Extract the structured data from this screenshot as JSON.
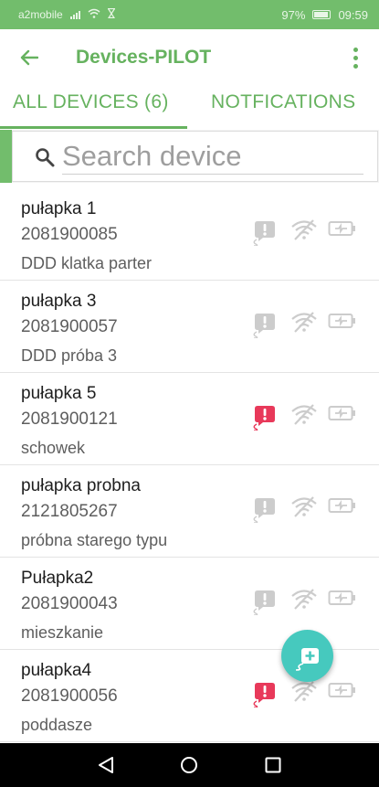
{
  "status_bar": {
    "carrier": "a2mobile",
    "battery": "97%",
    "time": "09:59"
  },
  "app_bar": {
    "title": "Devices-PILOT"
  },
  "tabs": [
    {
      "label": "ALL DEVICES (6)",
      "selected": true
    },
    {
      "label": "NOTFICATIONS",
      "selected": false
    }
  ],
  "search": {
    "placeholder": "Search device"
  },
  "devices": [
    {
      "name": "pułapka 1",
      "serial": "2081900085",
      "location": "DDD klatka parter",
      "alert": false
    },
    {
      "name": "pułapka 3",
      "serial": "2081900057",
      "location": "DDD próba 3",
      "alert": false
    },
    {
      "name": "pułapka 5",
      "serial": "2081900121",
      "location": "schowek",
      "alert": true
    },
    {
      "name": "pułapka probna",
      "serial": "2121805267",
      "location": "próbna starego typu",
      "alert": false
    },
    {
      "name": "Pułapka2",
      "serial": "2081900043",
      "location": "mieszkanie",
      "alert": false
    },
    {
      "name": "pułapka4",
      "serial": "2081900056",
      "location": "poddasze",
      "alert": true
    }
  ],
  "colors": {
    "primary": "#66b25f",
    "status_bar": "#72bd6c",
    "alert_active": "#e8395a",
    "icon_inactive": "#cccccc",
    "fab": "#46c9be"
  },
  "icons": {
    "alert": "trap-alert-icon",
    "signal": "no-signal-icon",
    "battery": "battery-icon",
    "fab": "add-device-icon"
  }
}
